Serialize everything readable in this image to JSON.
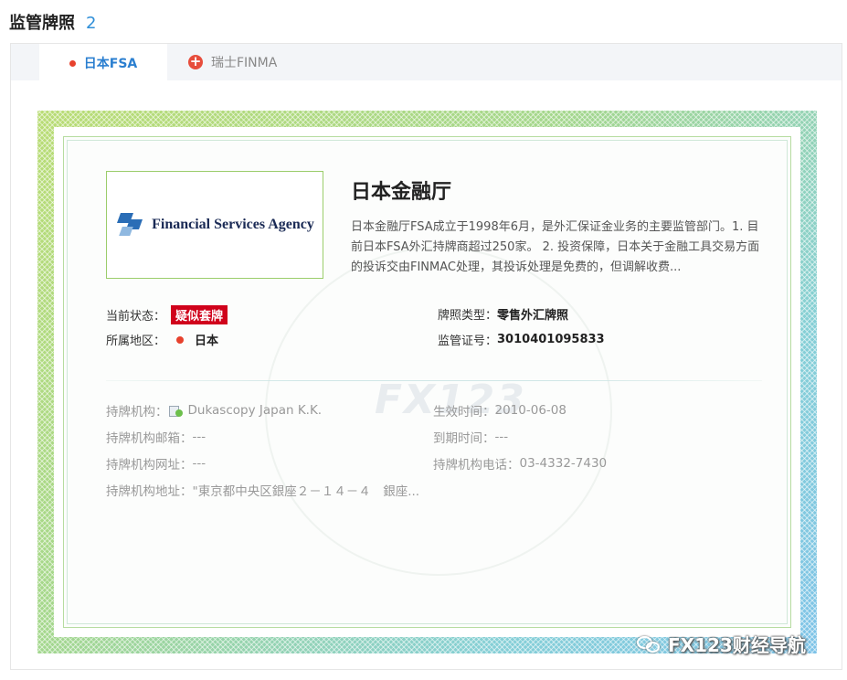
{
  "header": {
    "title": "监管牌照",
    "count": "2"
  },
  "tabs": [
    {
      "label": "日本FSA",
      "active": true,
      "icon": "red-dot"
    },
    {
      "label": "瑞士FINMA",
      "active": false,
      "icon": "plus-circle-icon"
    }
  ],
  "certificate": {
    "logo_text": "Financial Services Agency",
    "org_name": "日本金融厅",
    "description": "日本金融厅FSA成立于1998年6月，是外汇保证金业务的主要监管部门。1. 目前日本FSA外汇持牌商超过250家。 2. 投资保障，日本关于金融工具交易方面的投诉交由FINMAC处理，其投诉处理是免费的，但调解收费...",
    "status_label": "当前状态：",
    "status_value": "疑似套牌",
    "region_label": "所属地区：",
    "region_value": "日本",
    "license_type_label": "牌照类型：",
    "license_type_value": "零售外汇牌照",
    "license_no_label": "监管证号：",
    "license_no_value": "3010401095833",
    "holder_label": "持牌机构：",
    "holder_value": "Dukascopy Japan K.K.",
    "effective_label": "生效时间：",
    "effective_value": "2010-06-08",
    "email_label": "持牌机构邮箱：",
    "email_value": "---",
    "expiry_label": "到期时间：",
    "expiry_value": "---",
    "website_label": "持牌机构网址：",
    "website_value": "---",
    "phone_label": "持牌机构电话：",
    "phone_value": "03-4332-7430",
    "address_label": "持牌机构地址：",
    "address_value": "\"東京都中央区銀座２－１４－４　銀座...",
    "watermark": "FX123"
  },
  "footer": {
    "brand": "FX123财经导航"
  },
  "colors": {
    "accent": "#2b7fd0",
    "badge": "#d0021b",
    "dot": "#e7412d"
  }
}
